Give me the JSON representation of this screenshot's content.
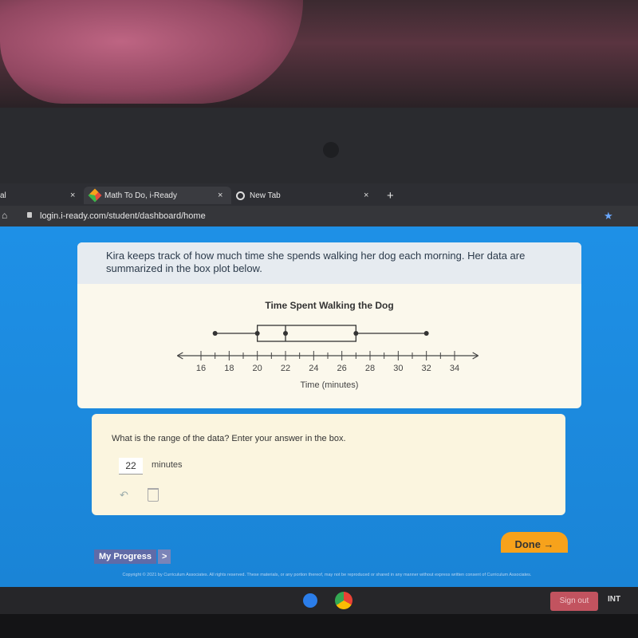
{
  "browser": {
    "tabs": [
      {
        "label": "al",
        "active": false
      },
      {
        "label": "Math To Do, i-Ready",
        "active": true
      },
      {
        "label": "New Tab",
        "active": false
      }
    ],
    "new_tab_symbol": "+",
    "close_symbol": "×",
    "url": "login.i-ready.com/student/dashboard/home"
  },
  "question": {
    "text": "Kira keeps track of how much time she spends walking her dog each morning. Her data are summarized in the box plot below."
  },
  "chart_data": {
    "type": "boxplot",
    "title": "Time Spent Walking the Dog",
    "xlabel": "Time (minutes)",
    "xlim": [
      15,
      35
    ],
    "ticks": [
      16,
      18,
      20,
      22,
      24,
      26,
      28,
      30,
      32,
      34
    ],
    "minor_ticks": [
      16,
      17,
      18,
      19,
      20,
      21,
      22,
      23,
      24,
      25,
      26,
      27,
      28,
      29,
      30,
      31,
      32,
      33,
      34
    ],
    "min": 17,
    "q1": 20,
    "median": 22,
    "q3": 27,
    "max": 32
  },
  "answer": {
    "prompt": "What is the range of the data? Enter your answer in the box.",
    "value": "22",
    "unit": "minutes"
  },
  "footer": {
    "done_label": "Done →",
    "progress_label": "My Progress",
    "progress_arrow": ">",
    "copyright": "Copyright © 2021 by Curriculum Associates. All rights reserved. These materials, or any portion thereof, may not be reproduced or shared in any manner without express written consent of Curriculum Associates."
  },
  "taskbar": {
    "signout_label": "Sign out",
    "int_label": "INT"
  }
}
